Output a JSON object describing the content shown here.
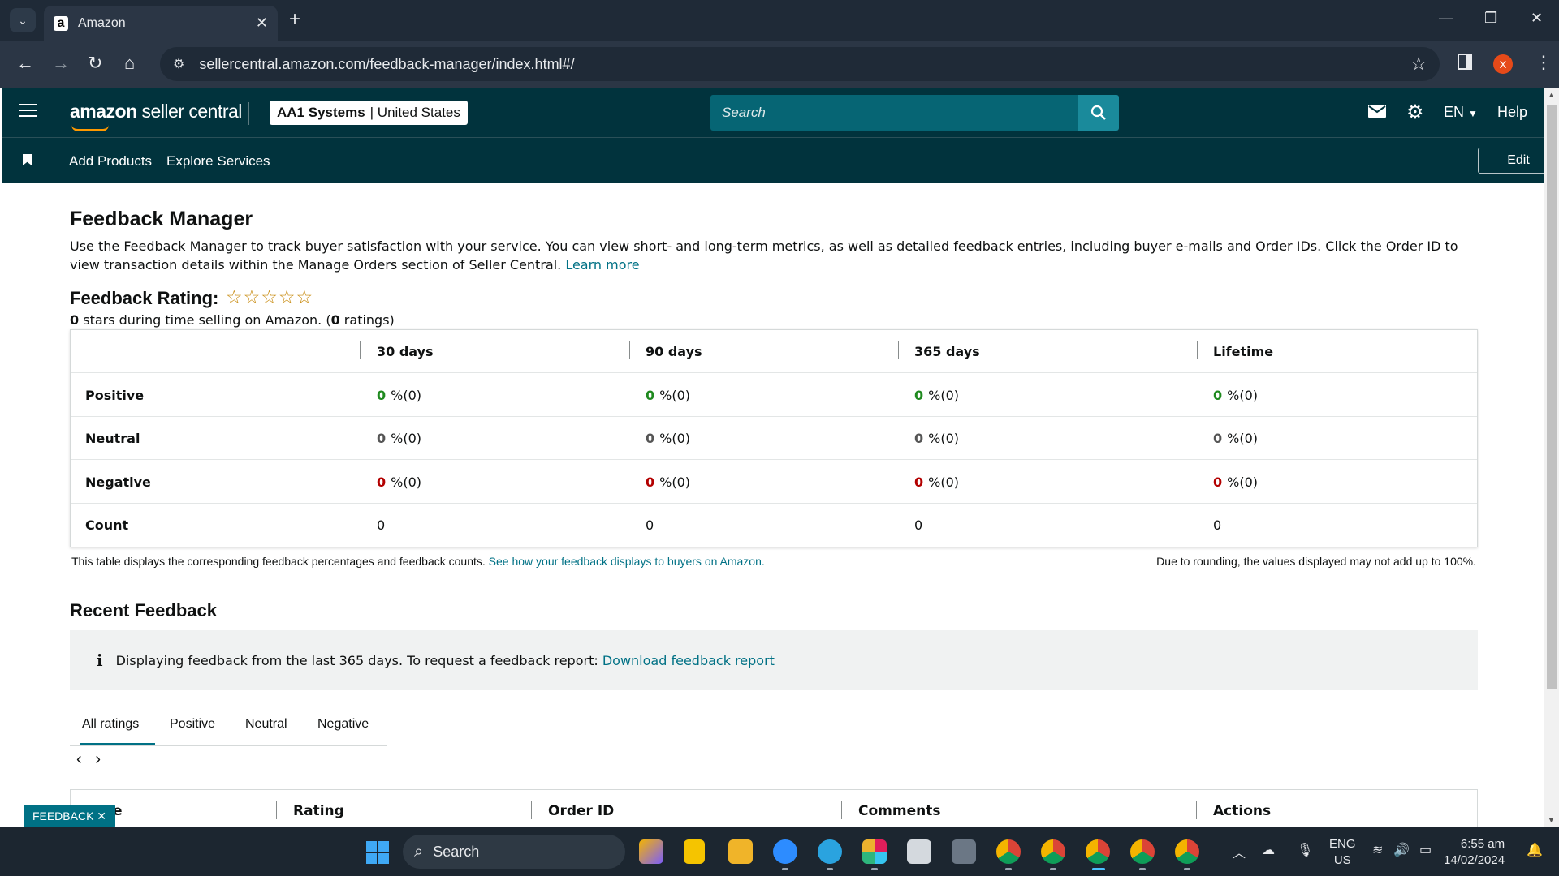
{
  "browser": {
    "tab_title": "Amazon",
    "url": "sellercentral.amazon.com/feedback-manager/index.html#/",
    "profile_initial": "X"
  },
  "header": {
    "logo_brand": "amazon",
    "logo_product": " seller central",
    "account_name": "AA1 Systems",
    "account_region": "| United States",
    "search_placeholder": "Search",
    "language": "EN",
    "help": "Help"
  },
  "subnav": {
    "links": [
      "Add Products",
      "Explore Services"
    ],
    "edit": "Edit"
  },
  "page": {
    "title": "Feedback Manager",
    "intro": "Use the Feedback Manager to track buyer satisfaction with your service. You can view short- and long-term metrics, as well as detailed feedback entries, including buyer e-mails and Order IDs. Click the Order ID to view transaction details within the Manage Orders section of Seller Central. ",
    "learn_more": "Learn more",
    "rating_title": "Feedback Rating:",
    "stars": "☆☆☆☆☆",
    "rating_stars_value": "0",
    "rating_stars_text": " stars during time selling on Amazon. (",
    "rating_count": "0",
    "rating_count_text": " ratings)"
  },
  "feedback_table": {
    "columns": [
      "30 days",
      "90 days",
      "365 days",
      "Lifetime"
    ],
    "rows": [
      {
        "label": "Positive",
        "cells": [
          {
            "n": "0",
            "p": "%(0)"
          },
          {
            "n": "0",
            "p": "%(0)"
          },
          {
            "n": "0",
            "p": "%(0)"
          },
          {
            "n": "0",
            "p": "%(0)"
          }
        ]
      },
      {
        "label": "Neutral",
        "cells": [
          {
            "n": "0",
            "p": "%(0)"
          },
          {
            "n": "0",
            "p": "%(0)"
          },
          {
            "n": "0",
            "p": "%(0)"
          },
          {
            "n": "0",
            "p": "%(0)"
          }
        ]
      },
      {
        "label": "Negative",
        "cells": [
          {
            "n": "0",
            "p": "%(0)"
          },
          {
            "n": "0",
            "p": "%(0)"
          },
          {
            "n": "0",
            "p": "%(0)"
          },
          {
            "n": "0",
            "p": "%(0)"
          }
        ]
      },
      {
        "label": "Count",
        "cells": [
          "0",
          "0",
          "0",
          "0"
        ]
      }
    ],
    "note": "This table displays the corresponding feedback percentages and feedback counts. ",
    "note_link": "See how your feedback displays to buyers on Amazon.",
    "note_right": "Due to rounding, the values displayed may not add up to 100%."
  },
  "recent": {
    "title": "Recent Feedback",
    "info_text": "Displaying feedback from the last 365 days. To request a feedback report: ",
    "info_link": "Download feedback report",
    "tabs": [
      "All ratings",
      "Positive",
      "Neutral",
      "Negative"
    ],
    "active_tab": "All ratings",
    "table_columns": [
      "e",
      "Rating",
      "Order ID",
      "Comments",
      "Actions"
    ]
  },
  "feedback_tag": "FEEDBACK ✕",
  "taskbar": {
    "search": "Search",
    "lang_top": "ENG",
    "lang_bottom": "US",
    "time": "6:55 am",
    "date": "14/02/2024"
  },
  "colors": {
    "header_bg": "#01333d",
    "accent": "#007185",
    "positive": "#1f8a1f",
    "negative": "#b30000",
    "star": "#c7880a"
  }
}
